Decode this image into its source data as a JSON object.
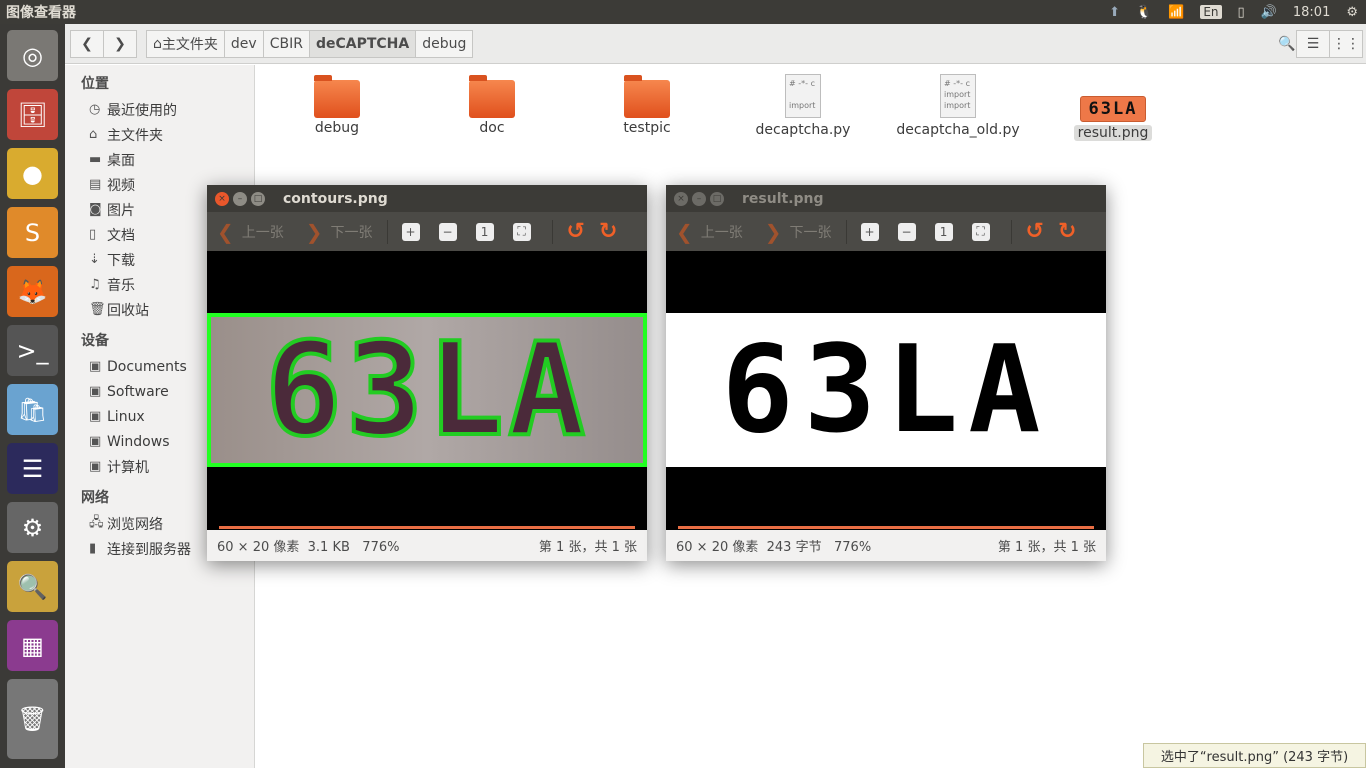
{
  "panel": {
    "title": "图像查看器",
    "input_method": "En",
    "time": "18:01"
  },
  "launcher": {
    "items": [
      "ubuntu-dash",
      "files",
      "chrome",
      "sublime-text",
      "firefox",
      "terminal",
      "software-center",
      "eclipse",
      "system-settings",
      "image-viewer",
      "workspace",
      "trash"
    ]
  },
  "nav": {
    "breadcrumbs": [
      "主文件夹",
      "dev",
      "CBIR",
      "deCAPTCHA",
      "debug"
    ],
    "active_index": 3
  },
  "sidebar": {
    "sections": [
      {
        "title": "位置",
        "items": [
          {
            "icon": "clock-icon",
            "label": "最近使用的"
          },
          {
            "icon": "home-icon",
            "label": "主文件夹"
          },
          {
            "icon": "desktop-icon",
            "label": "桌面"
          },
          {
            "icon": "video-icon",
            "label": "视频"
          },
          {
            "icon": "camera-icon",
            "label": "图片"
          },
          {
            "icon": "document-icon",
            "label": "文档"
          },
          {
            "icon": "download-icon",
            "label": "下载"
          },
          {
            "icon": "music-icon",
            "label": "音乐"
          },
          {
            "icon": "trash-icon",
            "label": "回收站"
          }
        ]
      },
      {
        "title": "设备",
        "items": [
          {
            "icon": "drive-icon",
            "label": "Documents"
          },
          {
            "icon": "drive-icon",
            "label": "Software"
          },
          {
            "icon": "drive-icon",
            "label": "Linux"
          },
          {
            "icon": "drive-icon",
            "label": "Windows"
          },
          {
            "icon": "drive-icon",
            "label": "计算机"
          }
        ]
      },
      {
        "title": "网络",
        "items": [
          {
            "icon": "network-icon",
            "label": "浏览网络"
          },
          {
            "icon": "server-icon",
            "label": "连接到服务器"
          }
        ]
      }
    ]
  },
  "files": [
    {
      "name": "debug",
      "type": "folder"
    },
    {
      "name": "doc",
      "type": "folder"
    },
    {
      "name": "testpic",
      "type": "folder"
    },
    {
      "name": "decaptcha.py",
      "type": "python",
      "preview": [
        "# -*- c",
        "",
        "import"
      ]
    },
    {
      "name": "decaptcha_old.py",
      "type": "python",
      "preview": [
        "# -*- c",
        "import",
        "import"
      ]
    },
    {
      "name": "result.png",
      "type": "image",
      "preview": "63LA",
      "selected": true
    }
  ],
  "viewers": [
    {
      "title": "contours.png",
      "prev": "上一张",
      "next": "下一张",
      "image_text": "63LA",
      "dims": "60 × 20 像素",
      "size": "3.1 KB",
      "zoom": "776%",
      "position": "第 1 张，共 1 张",
      "active": true
    },
    {
      "title": "result.png",
      "prev": "上一张",
      "next": "下一张",
      "image_text": "63LA",
      "dims": "60 × 20 像素",
      "size": "243 字节",
      "zoom": "776%",
      "position": "第 1 张，共 1 张",
      "active": false
    }
  ],
  "statusbar": {
    "text": "选中了“result.png” (243 字节)"
  },
  "colors": {
    "accent": "#e9572b",
    "folder": "#ef7440",
    "contour": "#22ff22"
  }
}
